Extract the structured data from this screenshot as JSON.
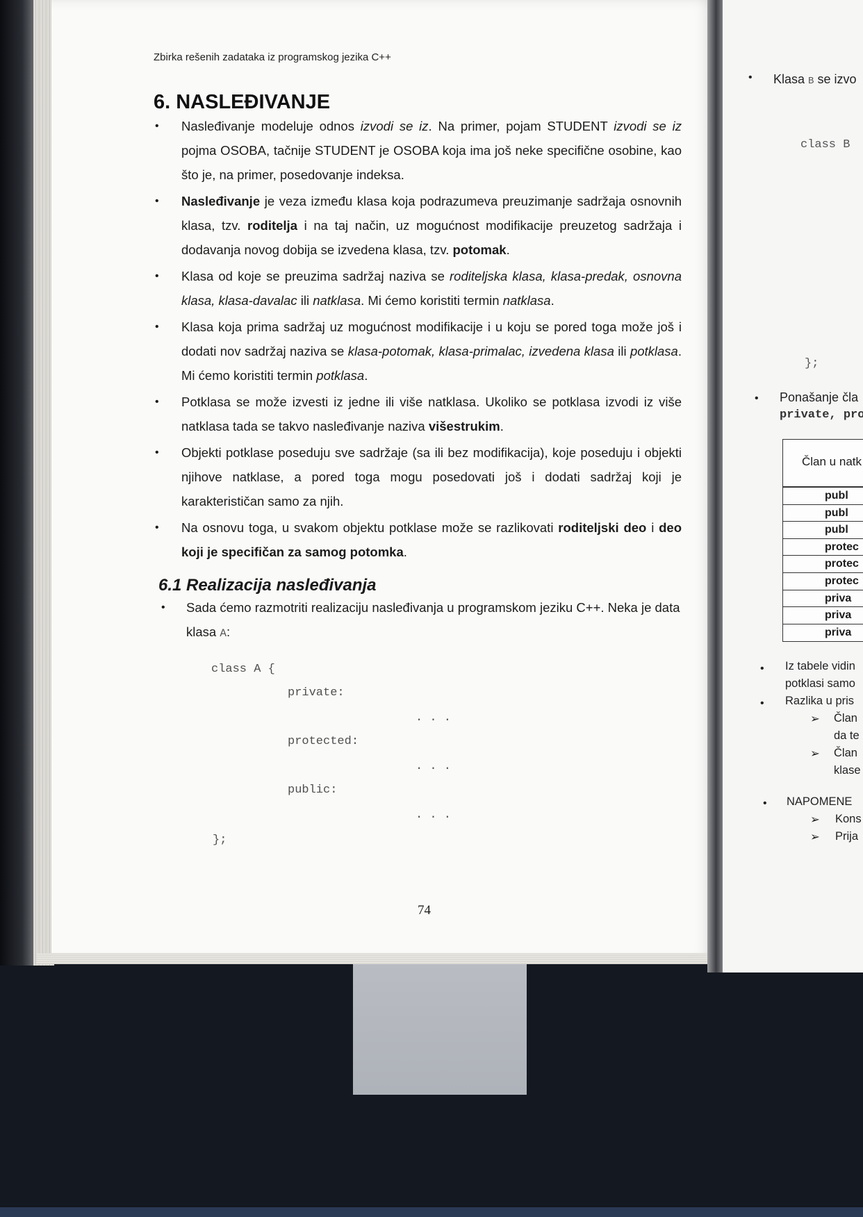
{
  "left_page": {
    "running_head": "Zbirka rešenih zadataka iz programskog jezika C++",
    "chapter_title": "6. NASLEĐIVANJE",
    "bullets": [
      {
        "parts": [
          {
            "t": "Nasleđivanje modeluje odnos "
          },
          {
            "t": "izvodi se iz",
            "s": "i"
          },
          {
            "t": ". Na primer, pojam STUDENT "
          },
          {
            "t": "izvodi se iz",
            "s": "i"
          },
          {
            "t": " pojma OSOBA, tačnije STUDENT je OSOBA koja ima još neke specifične osobine, kao što je, na primer, posedovanje indeksa."
          }
        ]
      },
      {
        "parts": [
          {
            "t": "Nasleđivanje",
            "s": "b"
          },
          {
            "t": " je veza između klasa koja podrazumeva preuzimanje sadržaja osnovnih klasa, tzv. "
          },
          {
            "t": "roditelja",
            "s": "b"
          },
          {
            "t": " i na taj način, uz mogućnost modifikacije preuzetog sadržaja i dodavanja novog dobija se izvedena klasa, tzv. "
          },
          {
            "t": "potomak",
            "s": "b"
          },
          {
            "t": "."
          }
        ]
      },
      {
        "parts": [
          {
            "t": "Klasa od koje se preuzima sadržaj naziva se "
          },
          {
            "t": "roditeljska klasa, klasa-predak, osnovna klasa, klasa-davalac",
            "s": "i"
          },
          {
            "t": " ili "
          },
          {
            "t": "natklasa",
            "s": "i"
          },
          {
            "t": ". Mi ćemo koristiti termin "
          },
          {
            "t": "natklasa",
            "s": "i"
          },
          {
            "t": "."
          }
        ]
      },
      {
        "parts": [
          {
            "t": "Klasa koja prima sadržaj uz mogućnost modifikacije i u koju se pored toga može još i dodati nov sadržaj naziva se "
          },
          {
            "t": "klasa-potomak, klasa-primalac, izvedena klasa",
            "s": "i"
          },
          {
            "t": " ili "
          },
          {
            "t": "potklasa",
            "s": "i"
          },
          {
            "t": ". Mi ćemo koristiti termin "
          },
          {
            "t": "potklasa",
            "s": "i"
          },
          {
            "t": "."
          }
        ]
      },
      {
        "parts": [
          {
            "t": "Potklasa se može izvesti iz jedne ili više natklasa. Ukoliko se potklasa izvodi iz više natklasa tada se takvo nasleđivanje naziva "
          },
          {
            "t": "višestrukim",
            "s": "b"
          },
          {
            "t": "."
          }
        ]
      },
      {
        "parts": [
          {
            "t": "Objekti potklase poseduju sve sadržaje (sa ili bez modifikacija), koje poseduju i objekti njihove natklase, a pored toga mogu posedovati još i dodati sadržaj koji je karakterističan samo za njih."
          }
        ]
      },
      {
        "parts": [
          {
            "t": "Na osnovu toga, u svakom objektu potklase može se razlikovati "
          },
          {
            "t": "roditeljski deo",
            "s": "b"
          },
          {
            "t": " i "
          },
          {
            "t": "deo koji je specifičan za samog potomka",
            "s": "b"
          },
          {
            "t": "."
          }
        ]
      }
    ],
    "section_title": "6.1 Realizacija nasleđivanja",
    "section_bullet": {
      "text_before": "Sada ćemo razmotriti realizaciju nasleđivanja u programskom jeziku C++. Neka je data klasa ",
      "code": "A",
      "text_after": ":"
    },
    "code": {
      "open": "class A {",
      "private": "private:",
      "protected": "protected:",
      "public": "public:",
      "dots": ". . .",
      "close": "};"
    },
    "page_number": "74"
  },
  "right_page": {
    "b1_prefix": "Klasa ",
    "b1_code": "B",
    "b1_suffix": " se izvo",
    "code_open": "class B",
    "code_close": "};",
    "b2_text": "Ponašanje čla",
    "b2_code": "private, pro",
    "table_header": "Član u natk",
    "table_rows": [
      "publ",
      "publ",
      "publ",
      "protec",
      "protec",
      "protec",
      "priva",
      "priva",
      "priva"
    ],
    "b3_line1": "Iz tabele vidin",
    "b3_line2": "potklasi samo",
    "b4_line1": "Razlika u pris",
    "sub1_line1": "Član",
    "sub1_line2": "da te",
    "sub2_line1": "Član",
    "sub2_line2": "klase",
    "b5_line1": "NAPOMENE",
    "sub3": "Kons",
    "sub4": "Prija"
  }
}
